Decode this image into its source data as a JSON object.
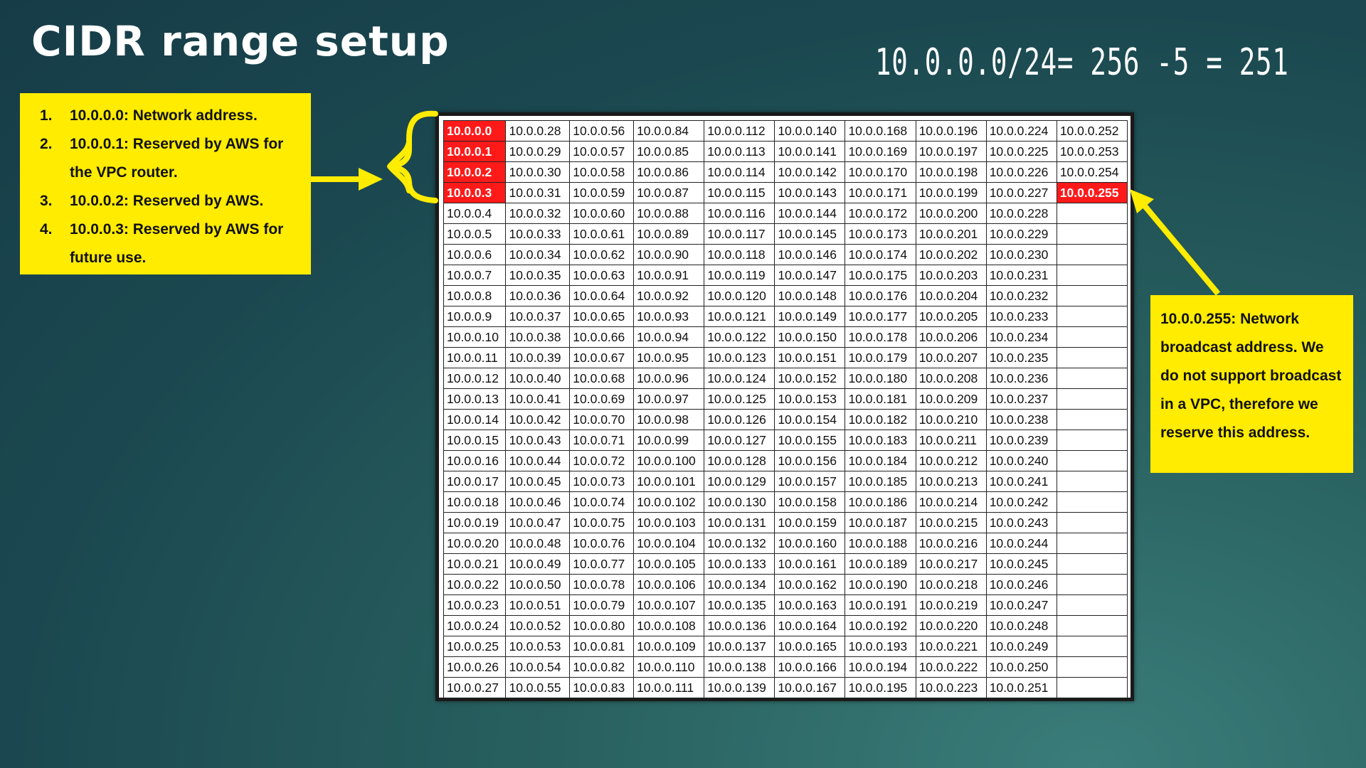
{
  "title": "CIDR range setup",
  "formula": "10.0.0.0/24= 256 -5 = 251",
  "reserved_notes": [
    {
      "num": "1.",
      "text": "10.0.0.0: Network address."
    },
    {
      "num": "2.",
      "text": "10.0.0.1: Reserved by AWS for the VPC router."
    },
    {
      "num": "3.",
      "text": "10.0.0.2: Reserved by AWS."
    },
    {
      "num": "4.",
      "text": "10.0.0.3: Reserved by AWS for future use."
    }
  ],
  "broadcast_note": "10.0.0.255: Network broadcast address. We do not support broadcast in a VPC, therefore we reserve this address.",
  "colors": {
    "note_yellow": "#ffec00",
    "highlight_red": "#ff1a1a",
    "arrow_yellow": "#ffec00"
  },
  "table": {
    "columns": [
      [
        "10.0.0.0",
        "10.0.0.1",
        "10.0.0.2",
        "10.0.0.3",
        "10.0.0.4",
        "10.0.0.5",
        "10.0.0.6",
        "10.0.0.7",
        "10.0.0.8",
        "10.0.0.9",
        "10.0.0.10",
        "10.0.0.11",
        "10.0.0.12",
        "10.0.0.13",
        "10.0.0.14",
        "10.0.0.15",
        "10.0.0.16",
        "10.0.0.17",
        "10.0.0.18",
        "10.0.0.19",
        "10.0.0.20",
        "10.0.0.21",
        "10.0.0.22",
        "10.0.0.23",
        "10.0.0.24",
        "10.0.0.25",
        "10.0.0.26",
        "10.0.0.27"
      ],
      [
        "10.0.0.28",
        "10.0.0.29",
        "10.0.0.30",
        "10.0.0.31",
        "10.0.0.32",
        "10.0.0.33",
        "10.0.0.34",
        "10.0.0.35",
        "10.0.0.36",
        "10.0.0.37",
        "10.0.0.38",
        "10.0.0.39",
        "10.0.0.40",
        "10.0.0.41",
        "10.0.0.42",
        "10.0.0.43",
        "10.0.0.44",
        "10.0.0.45",
        "10.0.0.46",
        "10.0.0.47",
        "10.0.0.48",
        "10.0.0.49",
        "10.0.0.50",
        "10.0.0.51",
        "10.0.0.52",
        "10.0.0.53",
        "10.0.0.54",
        "10.0.0.55"
      ],
      [
        "10.0.0.56",
        "10.0.0.57",
        "10.0.0.58",
        "10.0.0.59",
        "10.0.0.60",
        "10.0.0.61",
        "10.0.0.62",
        "10.0.0.63",
        "10.0.0.64",
        "10.0.0.65",
        "10.0.0.66",
        "10.0.0.67",
        "10.0.0.68",
        "10.0.0.69",
        "10.0.0.70",
        "10.0.0.71",
        "10.0.0.72",
        "10.0.0.73",
        "10.0.0.74",
        "10.0.0.75",
        "10.0.0.76",
        "10.0.0.77",
        "10.0.0.78",
        "10.0.0.79",
        "10.0.0.80",
        "10.0.0.81",
        "10.0.0.82",
        "10.0.0.83"
      ],
      [
        "10.0.0.84",
        "10.0.0.85",
        "10.0.0.86",
        "10.0.0.87",
        "10.0.0.88",
        "10.0.0.89",
        "10.0.0.90",
        "10.0.0.91",
        "10.0.0.92",
        "10.0.0.93",
        "10.0.0.94",
        "10.0.0.95",
        "10.0.0.96",
        "10.0.0.97",
        "10.0.0.98",
        "10.0.0.99",
        "10.0.0.100",
        "10.0.0.101",
        "10.0.0.102",
        "10.0.0.103",
        "10.0.0.104",
        "10.0.0.105",
        "10.0.0.106",
        "10.0.0.107",
        "10.0.0.108",
        "10.0.0.109",
        "10.0.0.110",
        "10.0.0.111"
      ],
      [
        "10.0.0.112",
        "10.0.0.113",
        "10.0.0.114",
        "10.0.0.115",
        "10.0.0.116",
        "10.0.0.117",
        "10.0.0.118",
        "10.0.0.119",
        "10.0.0.120",
        "10.0.0.121",
        "10.0.0.122",
        "10.0.0.123",
        "10.0.0.124",
        "10.0.0.125",
        "10.0.0.126",
        "10.0.0.127",
        "10.0.0.128",
        "10.0.0.129",
        "10.0.0.130",
        "10.0.0.131",
        "10.0.0.132",
        "10.0.0.133",
        "10.0.0.134",
        "10.0.0.135",
        "10.0.0.136",
        "10.0.0.137",
        "10.0.0.138",
        "10.0.0.139"
      ],
      [
        "10.0.0.140",
        "10.0.0.141",
        "10.0.0.142",
        "10.0.0.143",
        "10.0.0.144",
        "10.0.0.145",
        "10.0.0.146",
        "10.0.0.147",
        "10.0.0.148",
        "10.0.0.149",
        "10.0.0.150",
        "10.0.0.151",
        "10.0.0.152",
        "10.0.0.153",
        "10.0.0.154",
        "10.0.0.155",
        "10.0.0.156",
        "10.0.0.157",
        "10.0.0.158",
        "10.0.0.159",
        "10.0.0.160",
        "10.0.0.161",
        "10.0.0.162",
        "10.0.0.163",
        "10.0.0.164",
        "10.0.0.165",
        "10.0.0.166",
        "10.0.0.167"
      ],
      [
        "10.0.0.168",
        "10.0.0.169",
        "10.0.0.170",
        "10.0.0.171",
        "10.0.0.172",
        "10.0.0.173",
        "10.0.0.174",
        "10.0.0.175",
        "10.0.0.176",
        "10.0.0.177",
        "10.0.0.178",
        "10.0.0.179",
        "10.0.0.180",
        "10.0.0.181",
        "10.0.0.182",
        "10.0.0.183",
        "10.0.0.184",
        "10.0.0.185",
        "10.0.0.186",
        "10.0.0.187",
        "10.0.0.188",
        "10.0.0.189",
        "10.0.0.190",
        "10.0.0.191",
        "10.0.0.192",
        "10.0.0.193",
        "10.0.0.194",
        "10.0.0.195"
      ],
      [
        "10.0.0.196",
        "10.0.0.197",
        "10.0.0.198",
        "10.0.0.199",
        "10.0.0.200",
        "10.0.0.201",
        "10.0.0.202",
        "10.0.0.203",
        "10.0.0.204",
        "10.0.0.205",
        "10.0.0.206",
        "10.0.0.207",
        "10.0.0.208",
        "10.0.0.209",
        "10.0.0.210",
        "10.0.0.211",
        "10.0.0.212",
        "10.0.0.213",
        "10.0.0.214",
        "10.0.0.215",
        "10.0.0.216",
        "10.0.0.217",
        "10.0.0.218",
        "10.0.0.219",
        "10.0.0.220",
        "10.0.0.221",
        "10.0.0.222",
        "10.0.0.223"
      ],
      [
        "10.0.0.224",
        "10.0.0.225",
        "10.0.0.226",
        "10.0.0.227",
        "10.0.0.228",
        "10.0.0.229",
        "10.0.0.230",
        "10.0.0.231",
        "10.0.0.232",
        "10.0.0.233",
        "10.0.0.234",
        "10.0.0.235",
        "10.0.0.236",
        "10.0.0.237",
        "10.0.0.238",
        "10.0.0.239",
        "10.0.0.240",
        "10.0.0.241",
        "10.0.0.242",
        "10.0.0.243",
        "10.0.0.244",
        "10.0.0.245",
        "10.0.0.246",
        "10.0.0.247",
        "10.0.0.248",
        "10.0.0.249",
        "10.0.0.250",
        "10.0.0.251"
      ],
      [
        "10.0.0.252",
        "10.0.0.253",
        "10.0.0.254",
        "10.0.0.255",
        "",
        "",
        "",
        "",
        "",
        "",
        "",
        "",
        "",
        "",
        "",
        "",
        "",
        "",
        "",
        "",
        "",
        "",
        "",
        "",
        "",
        "",
        "",
        ""
      ]
    ],
    "highlighted": [
      "10.0.0.0",
      "10.0.0.1",
      "10.0.0.2",
      "10.0.0.3",
      "10.0.0.255"
    ]
  }
}
